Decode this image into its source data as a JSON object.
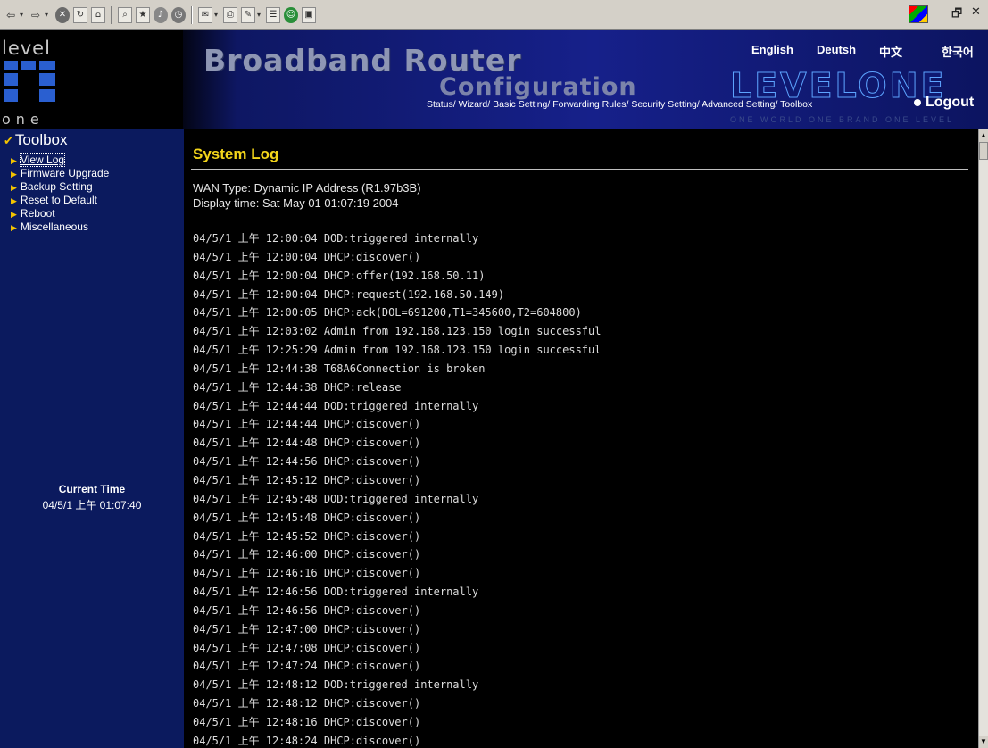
{
  "browser": {
    "buttons": [
      "back",
      "forward",
      "stop",
      "refresh",
      "home",
      "search",
      "favorites",
      "media",
      "history",
      "mail",
      "print",
      "edit",
      "discuss",
      "messenger"
    ],
    "back_glyph": "⇦",
    "forward_glyph": "⇨",
    "window_controls": [
      "–",
      "🗗",
      "✕"
    ]
  },
  "banner": {
    "logo_top": "level",
    "logo_bottom": "one",
    "title": "Broadband Router",
    "subtitle": "Configuration",
    "brand": "LEVELONE",
    "tagline": "ONE WORLD ONE BRAND ONE LEVEL",
    "languages": [
      "English",
      "Deutsh",
      "中文",
      "한국어"
    ],
    "nav": "Status/ Wizard/ Basic Setting/ Forwarding Rules/ Security Setting/ Advanced Setting/ Toolbox",
    "logout": "Logout"
  },
  "sidebar": {
    "header": "Toolbox",
    "items": [
      {
        "label": "View Log",
        "active": true
      },
      {
        "label": "Firmware Upgrade"
      },
      {
        "label": "Backup Setting"
      },
      {
        "label": "Reset to Default"
      },
      {
        "label": "Reboot"
      },
      {
        "label": "Miscellaneous"
      }
    ],
    "current_time_label": "Current Time",
    "current_time_value": "04/5/1 上午 01:07:40"
  },
  "main": {
    "title": "System Log",
    "wan_type": "WAN Type: Dynamic IP Address (R1.97b3B)",
    "display_time": "Display time: Sat May 01 01:07:19 2004",
    "log": [
      "04/5/1 上午 12:00:04 DOD:triggered internally",
      "04/5/1 上午 12:00:04 DHCP:discover()",
      "04/5/1 上午 12:00:04 DHCP:offer(192.168.50.11)",
      "04/5/1 上午 12:00:04 DHCP:request(192.168.50.149)",
      "04/5/1 上午 12:00:05 DHCP:ack(DOL=691200,T1=345600,T2=604800)",
      "04/5/1 上午 12:03:02 Admin from 192.168.123.150 login successful",
      "04/5/1 上午 12:25:29 Admin from 192.168.123.150 login successful",
      "04/5/1 上午 12:44:38 T68A6Connection is broken",
      "04/5/1 上午 12:44:38 DHCP:release",
      "04/5/1 上午 12:44:44 DOD:triggered internally",
      "04/5/1 上午 12:44:44 DHCP:discover()",
      "04/5/1 上午 12:44:48 DHCP:discover()",
      "04/5/1 上午 12:44:56 DHCP:discover()",
      "04/5/1 上午 12:45:12 DHCP:discover()",
      "04/5/1 上午 12:45:48 DOD:triggered internally",
      "04/5/1 上午 12:45:48 DHCP:discover()",
      "04/5/1 上午 12:45:52 DHCP:discover()",
      "04/5/1 上午 12:46:00 DHCP:discover()",
      "04/5/1 上午 12:46:16 DHCP:discover()",
      "04/5/1 上午 12:46:56 DOD:triggered internally",
      "04/5/1 上午 12:46:56 DHCP:discover()",
      "04/5/1 上午 12:47:00 DHCP:discover()",
      "04/5/1 上午 12:47:08 DHCP:discover()",
      "04/5/1 上午 12:47:24 DHCP:discover()",
      "04/5/1 上午 12:48:12 DOD:triggered internally",
      "04/5/1 上午 12:48:12 DHCP:discover()",
      "04/5/1 上午 12:48:16 DHCP:discover()",
      "04/5/1 上午 12:48:24 DHCP:discover()"
    ]
  },
  "colors": {
    "sidebar_bg": "#0b1a5e",
    "title_yellow": "#f3d51a",
    "main_bg": "#000000"
  }
}
